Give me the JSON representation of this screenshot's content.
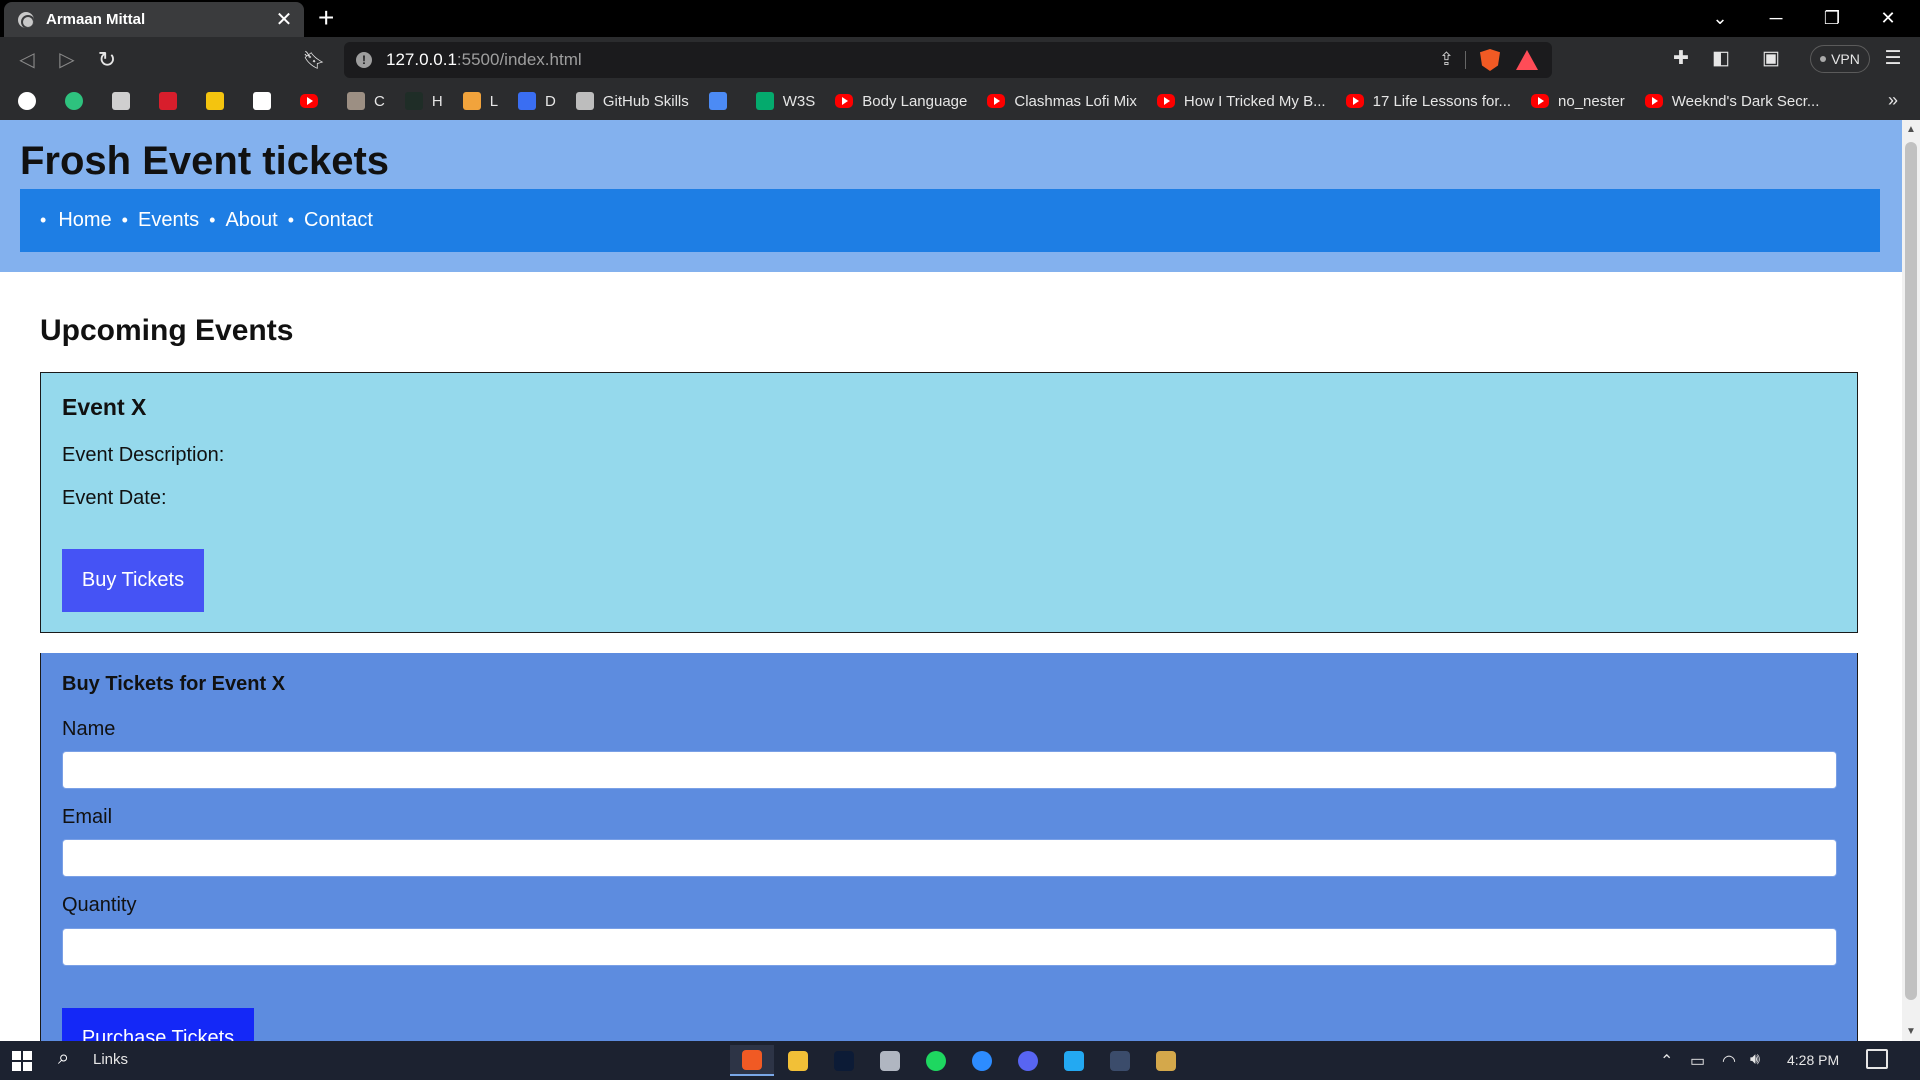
{
  "browser": {
    "tab_title": "Armaan Mittal",
    "new_tab_label": "+",
    "url_host": "127.0.0.1",
    "url_rest": ":5500/index.html",
    "vpn_label": "VPN",
    "bookmarks": [
      {
        "label": "",
        "color": "#ffffff"
      },
      {
        "label": "",
        "color": "#2ec27e"
      },
      {
        "label": "",
        "color": "#cfcfcf"
      },
      {
        "label": "",
        "color": "#d81e2c"
      },
      {
        "label": "",
        "color": "#f4c40f"
      },
      {
        "label": "",
        "color": "#ffffff"
      },
      {
        "label": "",
        "color": "#ff0000"
      },
      {
        "label": "C",
        "color": "#9c8f83"
      },
      {
        "label": "H",
        "color": "#1f2d27"
      },
      {
        "label": "L",
        "color": "#f1a33c"
      },
      {
        "label": "D",
        "color": "#3a6ef2"
      },
      {
        "label": "GitHub Skills",
        "color": "#bdbdbd"
      },
      {
        "label": "",
        "color": "#4c8bf5"
      },
      {
        "label": "W3S",
        "color": "#04aa6d"
      },
      {
        "label": "Body Language",
        "color": "#ff0000"
      },
      {
        "label": "Clashmas Lofi Mix",
        "color": "#ff0000"
      },
      {
        "label": "How I Tricked My B...",
        "color": "#ff0000"
      },
      {
        "label": "17 Life Lessons for...",
        "color": "#ff0000"
      },
      {
        "label": "no_nester",
        "color": "#ff0000"
      },
      {
        "label": "Weeknd's Dark Secr...",
        "color": "#ff0000"
      }
    ]
  },
  "site": {
    "title": "Frosh Event tickets",
    "nav": [
      "Home",
      "Events",
      "About",
      "Contact"
    ]
  },
  "events": {
    "heading": "Upcoming Events",
    "event_name": "Event X",
    "description_label": "Event Description:",
    "date_label": "Event Date:",
    "buy_button": "Buy Tickets"
  },
  "purchase_form": {
    "title": "Buy Tickets for Event X",
    "name_label": "Name",
    "email_label": "Email",
    "quantity_label": "Quantity",
    "name_value": "",
    "email_value": "",
    "quantity_value": "",
    "submit_button": "Purchase Tickets"
  },
  "taskbar": {
    "search_label": "Links",
    "clock": "4:28 PM",
    "apps": [
      {
        "name": "brave-app",
        "color": "#f15a24"
      },
      {
        "name": "file-explorer-app",
        "color": "#f2c037"
      },
      {
        "name": "photoshop-app",
        "color": "#0c1b36"
      },
      {
        "name": "chrome-like-app",
        "color": "#b0b6c1"
      },
      {
        "name": "spotify-app",
        "color": "#1ed760"
      },
      {
        "name": "zoom-app",
        "color": "#2d8cff"
      },
      {
        "name": "discord-app",
        "color": "#5865f2"
      },
      {
        "name": "vscode-app",
        "color": "#23a9f2"
      },
      {
        "name": "devtools-app",
        "color": "#3b4c6b"
      },
      {
        "name": "paint-app",
        "color": "#d4a84b"
      }
    ]
  }
}
